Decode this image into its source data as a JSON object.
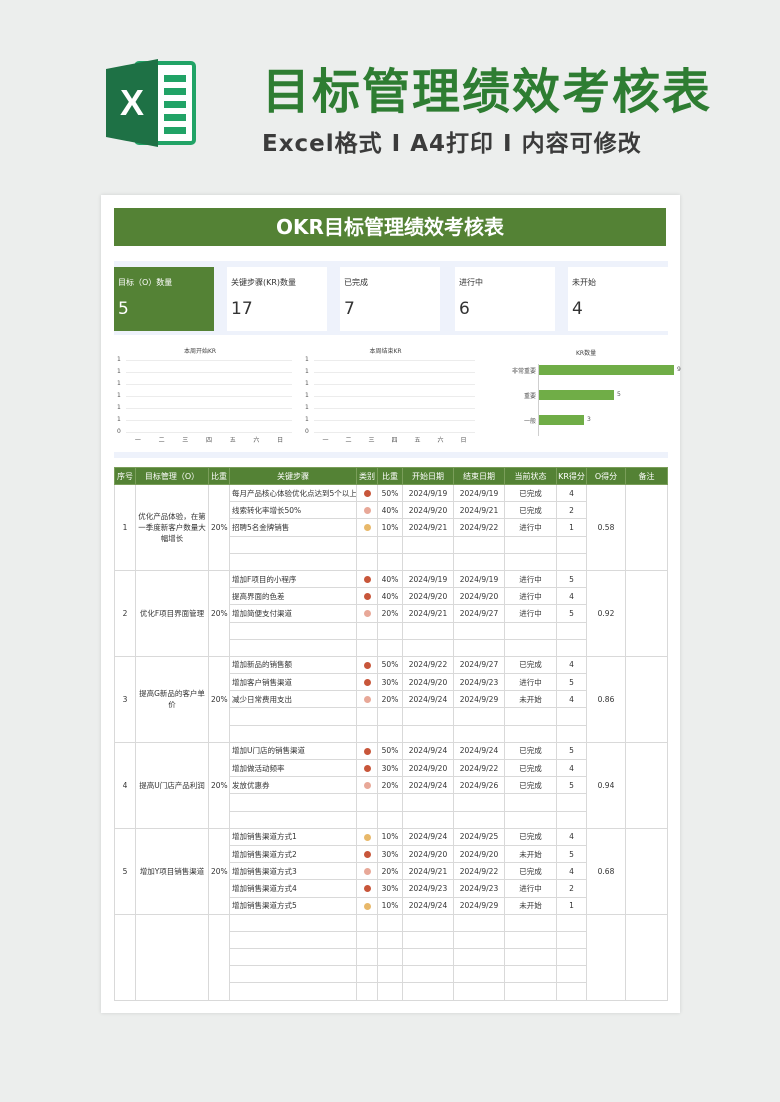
{
  "banner": {
    "logo_letter": "X",
    "title": "目标管理绩效考核表",
    "subtitle": "Excel格式 I A4打印 I 内容可修改"
  },
  "sheet": {
    "title": "OKR目标管理绩效考核表",
    "kpis": [
      {
        "label": "目标（O）数量",
        "value": "5"
      },
      {
        "label": "关键步骤(KR)数量",
        "value": "17"
      },
      {
        "label": "已完成",
        "value": "7"
      },
      {
        "label": "进行中",
        "value": "6"
      },
      {
        "label": "未开始",
        "value": "4"
      }
    ]
  },
  "chart_data": [
    {
      "type": "line",
      "title": "本周开始KR",
      "categories": [
        "一",
        "二",
        "三",
        "四",
        "五",
        "六",
        "日"
      ],
      "y_ticks": [
        "1",
        "1",
        "1",
        "1",
        "1",
        "1",
        "0"
      ]
    },
    {
      "type": "line",
      "title": "本周结束KR",
      "categories": [
        "一",
        "二",
        "三",
        "四",
        "五",
        "六",
        "日"
      ],
      "y_ticks": [
        "1",
        "1",
        "1",
        "1",
        "1",
        "1",
        "0"
      ]
    },
    {
      "type": "bar",
      "orientation": "horizontal",
      "title": "KR数量",
      "categories": [
        "非常重要",
        "重要",
        "一般"
      ],
      "values": [
        9,
        5,
        3
      ],
      "xlim": [
        0,
        10
      ]
    }
  ],
  "colors": {
    "header_green": "#548235",
    "bar_green": "#70ad47",
    "dot_red": "#c8563a",
    "dot_pink": "#e8a898",
    "dot_yellow": "#e8b86a",
    "status_done": "#3c6bd6"
  },
  "table": {
    "headers": [
      "序号",
      "目标管理（O）",
      "比重",
      "关键步骤",
      "类别",
      "比重",
      "开始日期",
      "结束日期",
      "当前状态",
      "KR得分",
      "O得分",
      "备注"
    ],
    "objectives": [
      {
        "no": "1",
        "objective": "优化产品体验，在第一季度新客户数量大幅增长",
        "weight": "20%",
        "score": "0.58",
        "krs": [
          {
            "step": "每月产品核心体验优化点达到5个以上",
            "dot": "red",
            "weight": "50%",
            "start": "2024/9/19",
            "end": "2024/9/19",
            "status": "已完成",
            "status_type": "done",
            "score": "4"
          },
          {
            "step": "线索转化率增长50%",
            "dot": "pink",
            "weight": "40%",
            "start": "2024/9/20",
            "end": "2024/9/21",
            "status": "已完成",
            "status_type": "done",
            "score": "2"
          },
          {
            "step": "招聘5名金牌销售",
            "dot": "yellow",
            "weight": "10%",
            "start": "2024/9/21",
            "end": "2024/9/22",
            "status": "进行中",
            "status_type": "normal",
            "score": "1"
          }
        ]
      },
      {
        "no": "2",
        "objective": "优化F项目界面管理",
        "weight": "20%",
        "score": "0.92",
        "krs": [
          {
            "step": "增加F项目的小程序",
            "dot": "red",
            "weight": "40%",
            "start": "2024/9/19",
            "end": "2024/9/19",
            "status": "进行中",
            "status_type": "normal",
            "score": "5"
          },
          {
            "step": "提高界面的色差",
            "dot": "red",
            "weight": "40%",
            "start": "2024/9/20",
            "end": "2024/9/20",
            "status": "进行中",
            "status_type": "normal",
            "score": "4"
          },
          {
            "step": "增加简便支付渠道",
            "dot": "pink",
            "weight": "20%",
            "start": "2024/9/21",
            "end": "2024/9/27",
            "status": "进行中",
            "status_type": "normal",
            "score": "5"
          }
        ]
      },
      {
        "no": "3",
        "objective": "提高G新品的客户单价",
        "weight": "20%",
        "score": "0.86",
        "krs": [
          {
            "step": "增加新品的销售额",
            "dot": "red",
            "weight": "50%",
            "start": "2024/9/22",
            "end": "2024/9/27",
            "status": "已完成",
            "status_type": "done",
            "score": "4"
          },
          {
            "step": "增加客户销售渠道",
            "dot": "red",
            "weight": "30%",
            "start": "2024/9/20",
            "end": "2024/9/23",
            "status": "进行中",
            "status_type": "normal",
            "score": "5"
          },
          {
            "step": "减少日常费用支出",
            "dot": "pink",
            "weight": "20%",
            "start": "2024/9/24",
            "end": "2024/9/29",
            "status": "未开始",
            "status_type": "normal",
            "score": "4"
          }
        ]
      },
      {
        "no": "4",
        "objective": "提高U门店产品利润",
        "weight": "20%",
        "score": "0.94",
        "krs": [
          {
            "step": "增加U门店的销售渠道",
            "dot": "red",
            "weight": "50%",
            "start": "2024/9/24",
            "end": "2024/9/24",
            "status": "已完成",
            "status_type": "done",
            "score": "5"
          },
          {
            "step": "增加做活动频率",
            "dot": "red",
            "weight": "30%",
            "start": "2024/9/20",
            "end": "2024/9/22",
            "status": "已完成",
            "status_type": "done",
            "score": "4"
          },
          {
            "step": "发放优惠券",
            "dot": "pink",
            "weight": "20%",
            "start": "2024/9/24",
            "end": "2024/9/26",
            "status": "已完成",
            "status_type": "done",
            "score": "5"
          }
        ]
      },
      {
        "no": "5",
        "objective": "增加Y项目销售渠道",
        "weight": "20%",
        "score": "0.68",
        "krs": [
          {
            "step": "增加销售渠道方式1",
            "dot": "yellow",
            "weight": "10%",
            "start": "2024/9/24",
            "end": "2024/9/25",
            "status": "已完成",
            "status_type": "done",
            "score": "4"
          },
          {
            "step": "增加销售渠道方式2",
            "dot": "red",
            "weight": "30%",
            "start": "2024/9/20",
            "end": "2024/9/20",
            "status": "未开始",
            "status_type": "normal",
            "score": "5"
          },
          {
            "step": "增加销售渠道方式3",
            "dot": "pink",
            "weight": "20%",
            "start": "2024/9/21",
            "end": "2024/9/22",
            "status": "已完成",
            "status_type": "done",
            "score": "4"
          },
          {
            "step": "增加销售渠道方式4",
            "dot": "red",
            "weight": "30%",
            "start": "2024/9/23",
            "end": "2024/9/23",
            "status": "进行中",
            "status_type": "normal",
            "score": "2"
          },
          {
            "step": "增加销售渠道方式5",
            "dot": "yellow",
            "weight": "10%",
            "start": "2024/9/24",
            "end": "2024/9/29",
            "status": "未开始",
            "status_type": "normal",
            "score": "1"
          }
        ]
      }
    ]
  }
}
